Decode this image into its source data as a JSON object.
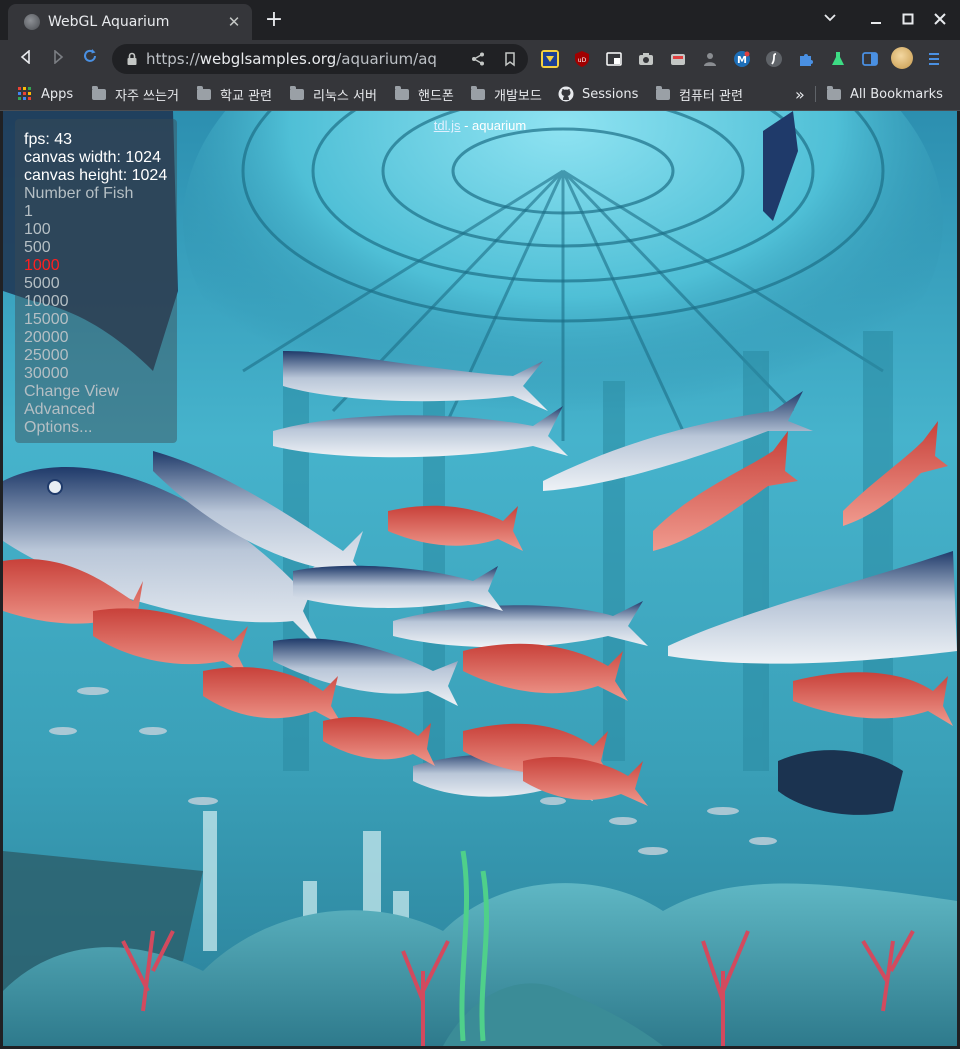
{
  "browser": {
    "tab_title": "WebGL Aquarium",
    "url_prefix": "https://",
    "url_host": "webglsamples.org",
    "url_rest": "/aquarium/aqua…",
    "bookmarks": [
      {
        "label": "Apps",
        "icon": "apps-grid-icon"
      },
      {
        "label": "자주 쓰는거",
        "icon": "folder-icon"
      },
      {
        "label": "학교 관련",
        "icon": "folder-icon"
      },
      {
        "label": "리눅스 서버",
        "icon": "folder-icon"
      },
      {
        "label": "핸드폰",
        "icon": "folder-icon"
      },
      {
        "label": "개발보드",
        "icon": "folder-icon"
      },
      {
        "label": "Sessions",
        "icon": "github-icon"
      },
      {
        "label": "컴퓨터 관련",
        "icon": "folder-icon"
      }
    ],
    "overflow_label": "»",
    "all_bookmarks_label": "All Bookmarks"
  },
  "page": {
    "header_link": "tdl.js",
    "header_rest": " - aquarium",
    "fps_line": "fps: 43",
    "canvas_width_line": "canvas width: 1024",
    "canvas_height_line": "canvas height: 1024",
    "number_of_fish_label": "Number of Fish",
    "fish_options": [
      "1",
      "100",
      "500",
      "1000",
      "5000",
      "10000",
      "15000",
      "20000",
      "25000",
      "30000"
    ],
    "selected_fish_option": "1000",
    "change_view_label": "Change View",
    "advanced_label": "Advanced",
    "options_label": "Options..."
  },
  "colors": {
    "selected_option": "#ff2020",
    "tab_bg": "#35363a",
    "frame_bg": "#202124",
    "water": "#3aa6c0"
  }
}
